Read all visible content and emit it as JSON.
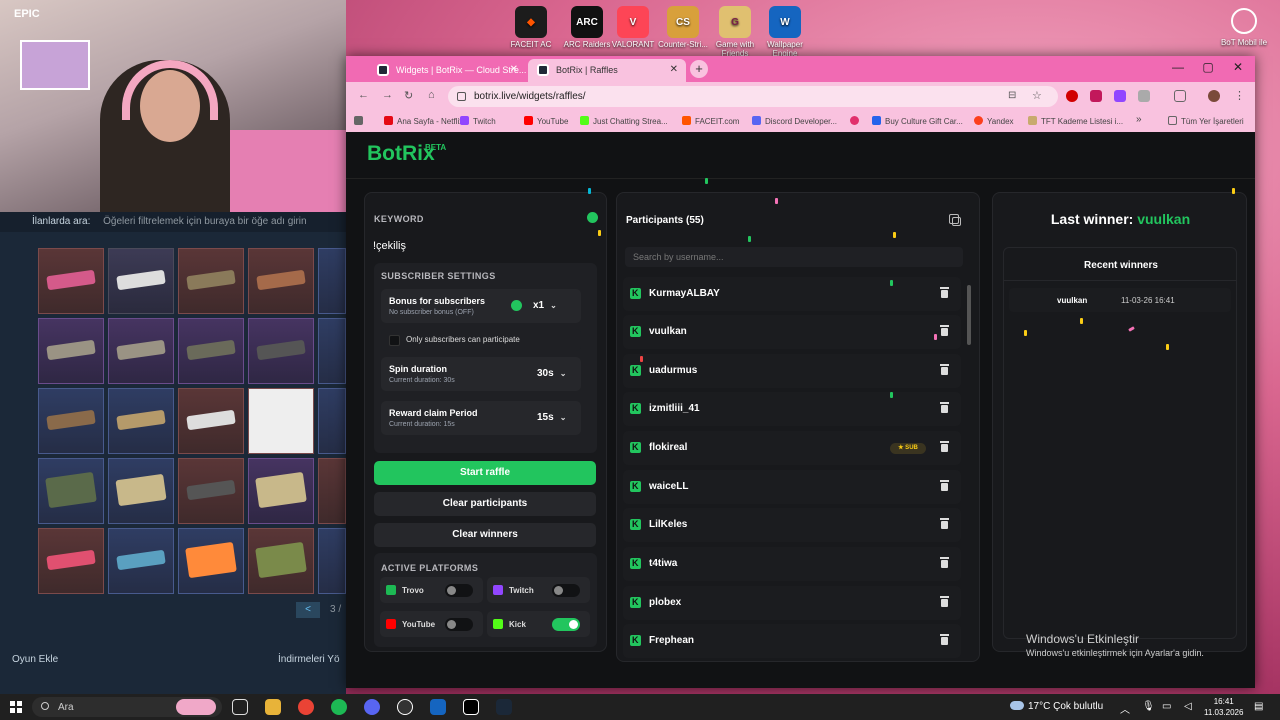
{
  "desktop": {
    "icons": [
      {
        "label": "FACEIT AC",
        "color": "#ff5500"
      },
      {
        "label": "ARC Raiders",
        "color": "#111111"
      },
      {
        "label": "VALORANT",
        "color": "#fd4556"
      },
      {
        "label": "Counter-Stri...",
        "color": "#d8a03b"
      },
      {
        "label": "Game with Friends",
        "color": "#e0c070"
      },
      {
        "label": "Wallpaper Engine",
        "color": "#1565c0"
      }
    ],
    "corner_label": "BoT Mobil ile"
  },
  "stream": {
    "overlay_tag": "EPIC",
    "game_search_label": "İlanlarda ara:",
    "game_search_placeholder": "Öğeleri filtrelemek için buraya bir öğe adı girin",
    "page_button": "<",
    "page_number": "3 /",
    "footer_left": "Oyun Ekle",
    "footer_right": "İndirmeleri Yö"
  },
  "browser": {
    "tabs": [
      {
        "label": "Widgets | BotRix — Cloud Stre..."
      },
      {
        "label": "BotRix | Raffles"
      }
    ],
    "url": "botrix.live/widgets/raffles/",
    "bookmarks": [
      {
        "label": "Ana Sayfa - Netflix",
        "color": "#e50914"
      },
      {
        "label": "Twitch",
        "color": "#9146ff"
      },
      {
        "label": "YouTube",
        "color": "#ff0000"
      },
      {
        "label": "Just Chatting Strea...",
        "color": "#53fc18"
      },
      {
        "label": "FACEIT.com",
        "color": "#ff5500"
      },
      {
        "label": "Discord Developer...",
        "color": "#5865f2"
      },
      {
        "label": "",
        "color": "#e1306c"
      },
      {
        "label": "Buy Culture Gift Car...",
        "color": "#2563eb"
      },
      {
        "label": "Yandex",
        "color": "#fc3f1d"
      },
      {
        "label": "TFT Kademe Listesi i...",
        "color": "#c8aa6e"
      }
    ],
    "bookmarks_more": "»",
    "all_bookmarks": "Tüm Yer İşaretleri"
  },
  "botrix": {
    "brand": "BotRix",
    "badge": "BETA",
    "keyword_label": "KEYWORD",
    "keyword_value": "!çekiliş",
    "subscriber_settings": "SUBSCRIBER SETTINGS",
    "bonus_title": "Bonus for subscribers",
    "bonus_sub": "No subscriber bonus (OFF)",
    "bonus_value": "x1",
    "only_subs": "Only subscribers can participate",
    "spin_title": "Spin duration",
    "spin_sub": "Current duration: 30s",
    "spin_value": "30s",
    "reward_title": "Reward claim Period",
    "reward_sub": "Current duration: 15s",
    "reward_value": "15s",
    "start_raffle": "Start raffle",
    "clear_participants": "Clear participants",
    "clear_winners": "Clear winners",
    "active_platforms": "ACTIVE PLATFORMS",
    "platforms": [
      {
        "name": "Trovo",
        "enabled": false,
        "color": "#1db954"
      },
      {
        "name": "Twitch",
        "enabled": false,
        "color": "#9146ff"
      },
      {
        "name": "YouTube",
        "enabled": false,
        "color": "#ff0000"
      },
      {
        "name": "Kick",
        "enabled": true,
        "color": "#53fc18"
      }
    ],
    "participants_title": "Participants (55)",
    "search_placeholder": "Search by username...",
    "participants": [
      {
        "name": "KurmayALBAY"
      },
      {
        "name": "vuulkan"
      },
      {
        "name": "uadurmus"
      },
      {
        "name": "izmitliii_41"
      },
      {
        "name": "flokireal",
        "badge": "★ SUB"
      },
      {
        "name": "waiceLL"
      },
      {
        "name": "LilKeles"
      },
      {
        "name": "t4tiwa"
      },
      {
        "name": "plobex"
      },
      {
        "name": "Frephean"
      }
    ],
    "last_winner_label": "Last winner:",
    "last_winner_name": "vuulkan",
    "recent_winners_title": "Recent winners",
    "recent_winners": [
      {
        "name": "vuulkan",
        "time": "11-03-26 16:41"
      }
    ]
  },
  "windows": {
    "activate_title": "Windows'u Etkinleştir",
    "activate_sub": "Windows'u etkinleştirmek için Ayarlar'a gidin."
  },
  "taskbar": {
    "search": "Ara",
    "weather": "17°C  Çok bulutlu",
    "time": "16:41",
    "date": "11.03.2026"
  }
}
